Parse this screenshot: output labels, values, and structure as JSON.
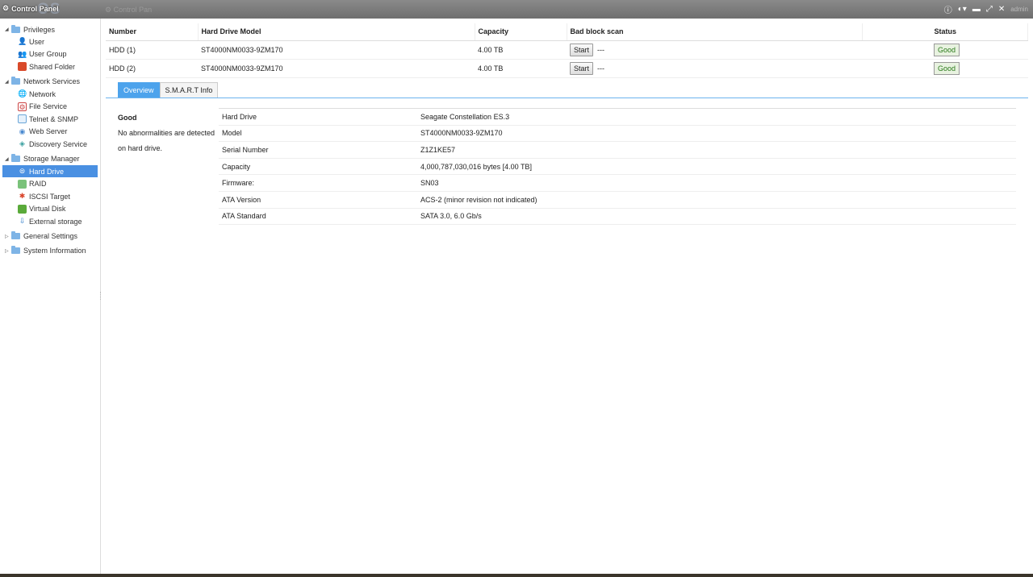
{
  "window": {
    "title": "Control Panel",
    "logo": "OS",
    "breadcrumb": "Control Pan",
    "user": "admin"
  },
  "sidebar": {
    "groups": [
      {
        "label": "Privileges",
        "items": [
          "User",
          "User Group",
          "Shared Folder"
        ]
      },
      {
        "label": "Network Services",
        "items": [
          "Network",
          "File Service",
          "Telnet & SNMP",
          "Web Server",
          "Discovery Service"
        ]
      },
      {
        "label": "Storage Manager",
        "items": [
          "Hard Drive",
          "RAID",
          "ISCSI Target",
          "Virtual Disk",
          "External storage"
        ]
      },
      {
        "label": "General Settings",
        "items": []
      },
      {
        "label": "System Information",
        "items": []
      }
    ],
    "active": "Hard Drive"
  },
  "drives": {
    "headers": {
      "number": "Number",
      "model": "Hard Drive Model",
      "capacity": "Capacity",
      "scan": "Bad block scan",
      "status": "Status"
    },
    "rows": [
      {
        "number": "HDD (1)",
        "model": "ST4000NM0033-9ZM170",
        "capacity": "4.00 TB",
        "scan_button": "Start",
        "scan_result": "---",
        "status": "Good"
      },
      {
        "number": "HDD (2)",
        "model": "ST4000NM0033-9ZM170",
        "capacity": "4.00 TB",
        "scan_button": "Start",
        "scan_result": "---",
        "status": "Good"
      }
    ]
  },
  "tabs": {
    "overview": "Overview",
    "smart": "S.M.A.R.T Info"
  },
  "summary": {
    "status": "Good",
    "message_line1": "No abnormalities are detected",
    "message_line2": "on hard drive."
  },
  "details": [
    {
      "key": "Hard Drive",
      "value": "Seagate Constellation ES.3"
    },
    {
      "key": "Model",
      "value": "ST4000NM0033-9ZM170"
    },
    {
      "key": "Serial Number",
      "value": "Z1Z1KE57"
    },
    {
      "key": "Capacity",
      "value": "4,000,787,030,016 bytes [4.00 TB]"
    },
    {
      "key": "Firmware:",
      "value": "SN03"
    },
    {
      "key": "ATA Version",
      "value": "ACS-2 (minor revision not indicated)"
    },
    {
      "key": "ATA Standard",
      "value": "SATA 3.0, 6.0 Gb/s"
    }
  ]
}
